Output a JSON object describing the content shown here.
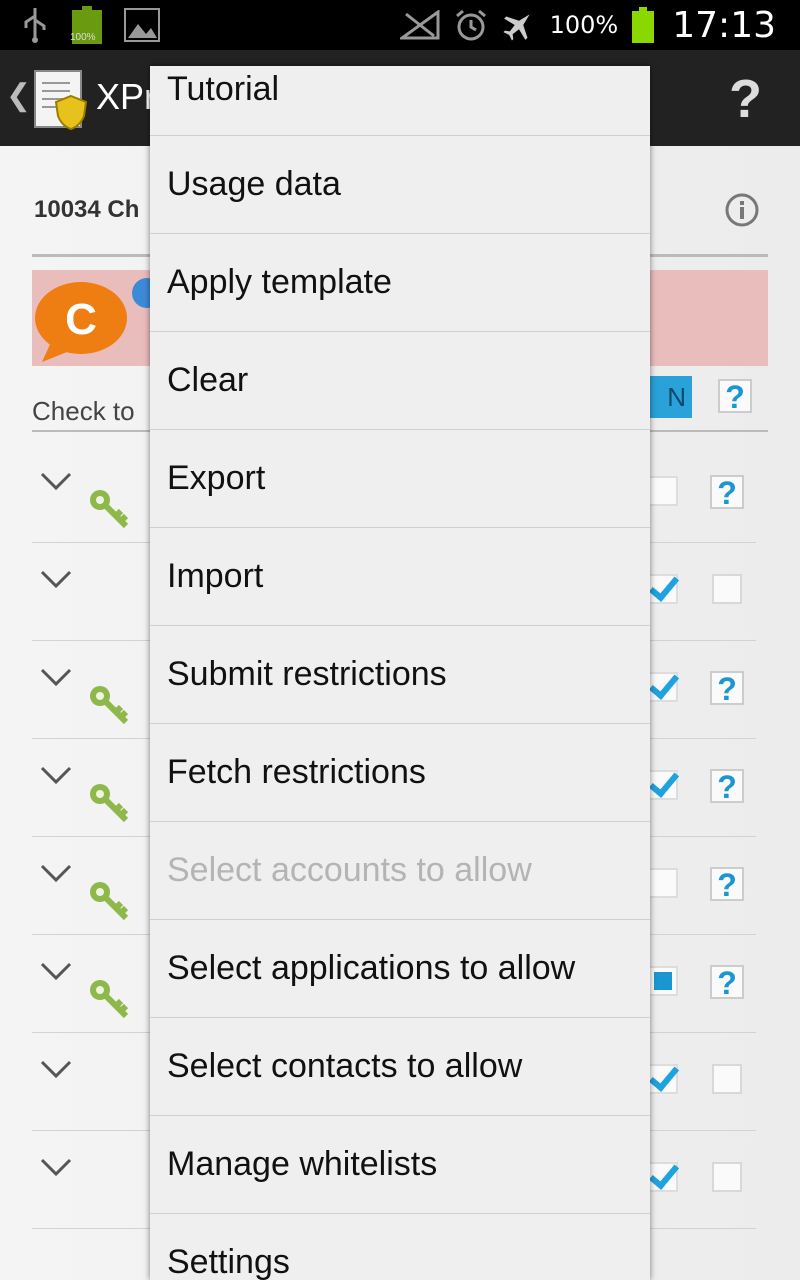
{
  "status_bar": {
    "icons": [
      "usb-icon",
      "battery-full-icon",
      "gallery-icon",
      "no-signal-icon",
      "alarm-icon",
      "airplane-icon"
    ],
    "left_battery_label": "100%",
    "battery_percent": "100%",
    "time": "17:13",
    "battery_color": "#8bd800"
  },
  "action_bar": {
    "title": "XPr",
    "help_label": "?"
  },
  "content": {
    "app_label": "10034 Ch",
    "check_hint": "Check to",
    "toggle_label": "N",
    "rows": [
      {
        "key": true,
        "state": "empty",
        "help": true
      },
      {
        "key": false,
        "state": "checked",
        "help": false
      },
      {
        "key": true,
        "state": "checked",
        "help": true
      },
      {
        "key": true,
        "state": "checked",
        "help": true
      },
      {
        "key": true,
        "state": "empty",
        "help": true
      },
      {
        "key": true,
        "state": "partial",
        "help": true
      },
      {
        "key": false,
        "state": "checked",
        "help": false
      },
      {
        "key": false,
        "state": "checked",
        "help": false
      }
    ]
  },
  "menu": {
    "items": [
      {
        "label": "Tutorial",
        "enabled": true
      },
      {
        "label": "Usage data",
        "enabled": true
      },
      {
        "label": "Apply template",
        "enabled": true
      },
      {
        "label": "Clear",
        "enabled": true
      },
      {
        "label": "Export",
        "enabled": true
      },
      {
        "label": "Import",
        "enabled": true
      },
      {
        "label": "Submit restrictions",
        "enabled": true
      },
      {
        "label": "Fetch restrictions",
        "enabled": true
      },
      {
        "label": "Select accounts to allow",
        "enabled": false
      },
      {
        "label": "Select applications to allow",
        "enabled": true
      },
      {
        "label": "Select contacts to allow",
        "enabled": true
      },
      {
        "label": "Manage whitelists",
        "enabled": true
      },
      {
        "label": "Settings",
        "enabled": true
      }
    ]
  },
  "colors": {
    "accent": "#1fa3e0",
    "pink_band": "#eabdbd",
    "key_green": "#8fb84a"
  }
}
